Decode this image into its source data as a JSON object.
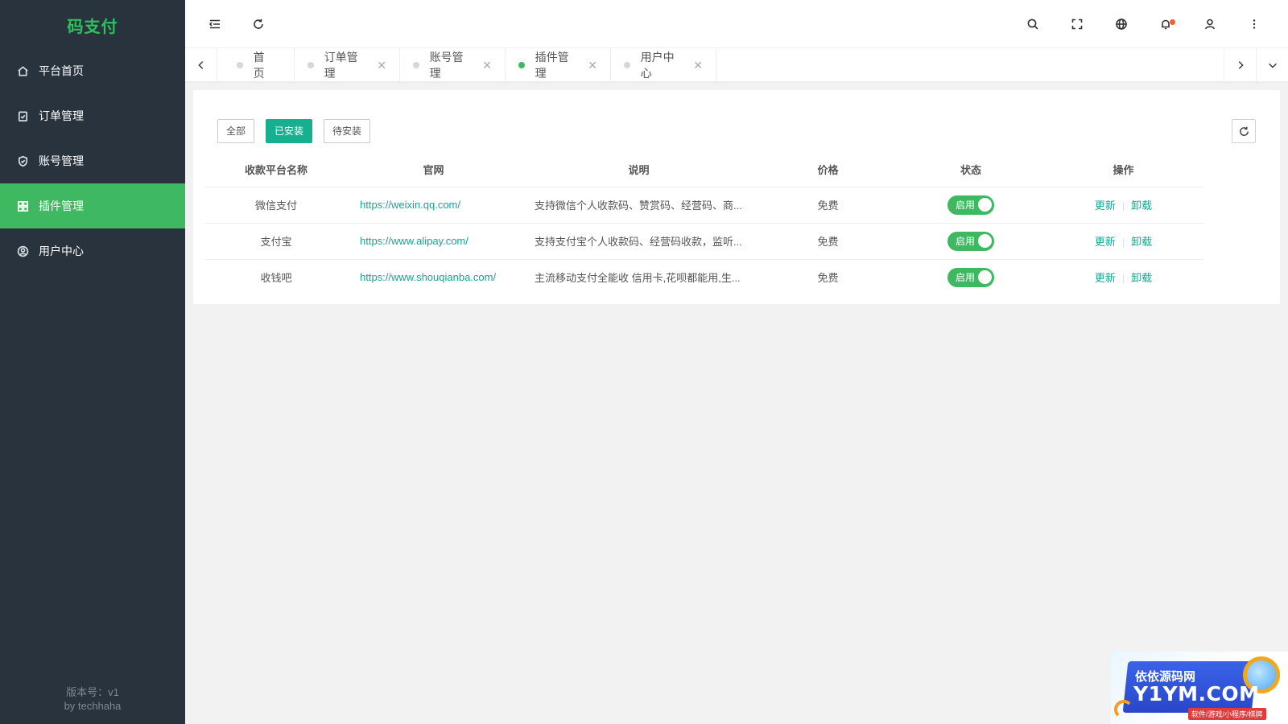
{
  "app": {
    "title": "码支付"
  },
  "sidebar": {
    "items": [
      {
        "label": "平台首页",
        "icon": "home-icon",
        "active": false
      },
      {
        "label": "订单管理",
        "icon": "clipboard-check-icon",
        "active": false
      },
      {
        "label": "账号管理",
        "icon": "shield-check-icon",
        "active": false
      },
      {
        "label": "插件管理",
        "icon": "grid-icon",
        "active": true
      },
      {
        "label": "用户中心",
        "icon": "user-circle-icon",
        "active": false
      }
    ],
    "version": "版本号：v1",
    "author": "by techhaha"
  },
  "header": {
    "icons": [
      "menu-fold-icon",
      "refresh-icon",
      "search-icon",
      "fullscreen-icon",
      "globe-icon",
      "bell-icon",
      "user-icon",
      "more-icon"
    ]
  },
  "tabs": [
    {
      "label": "首页",
      "closable": false,
      "active": false
    },
    {
      "label": "订单管理",
      "closable": true,
      "active": false
    },
    {
      "label": "账号管理",
      "closable": true,
      "active": false
    },
    {
      "label": "插件管理",
      "closable": true,
      "active": true
    },
    {
      "label": "用户中心",
      "closable": true,
      "active": false
    }
  ],
  "filters": {
    "all": "全部",
    "installed": "已安装",
    "pending": "待安装",
    "active": "installed"
  },
  "table": {
    "columns": [
      "收款平台名称",
      "官网",
      "说明",
      "价格",
      "状态",
      "操作"
    ],
    "rows": [
      {
        "name": "微信支付",
        "url": "https://weixin.qq.com/",
        "desc": "支持微信个人收款码、赞赏码、经营码、商...",
        "price": "免费",
        "status": "启用",
        "op_update": "更新",
        "op_uninstall": "卸载"
      },
      {
        "name": "支付宝",
        "url": "https://www.alipay.com/",
        "desc": "支持支付宝个人收款码、经营码收款，监听...",
        "price": "免费",
        "status": "启用",
        "op_update": "更新",
        "op_uninstall": "卸载"
      },
      {
        "name": "收钱吧",
        "url": "https://www.shouqianba.com/",
        "desc": "主流移动支付全能收 信用卡,花呗都能用,生...",
        "price": "免费",
        "status": "启用",
        "op_update": "更新",
        "op_uninstall": "卸载"
      }
    ]
  },
  "watermark": {
    "line1": "依依源码网",
    "line2": "Y1YM.COM",
    "line3": "软件/游戏/小程序/棋牌"
  },
  "colors": {
    "sidebar_bg": "#28333e",
    "accent": "#3eb961",
    "teal": "#16b091",
    "link": "#16a592"
  }
}
